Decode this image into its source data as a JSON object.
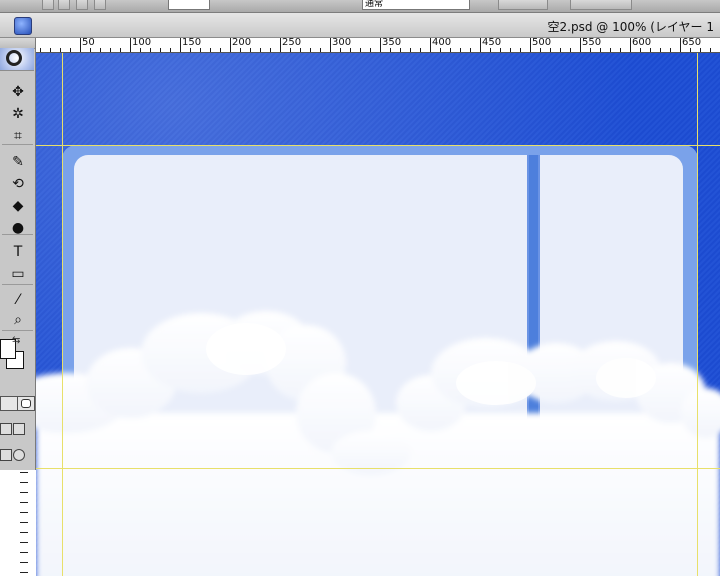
{
  "window": {
    "document_title": "空2.psd @ 100% (レイヤー 1"
  },
  "options_bar": {
    "mode_value": "通常"
  },
  "ruler": {
    "labels": [
      "50",
      "100",
      "150",
      "200",
      "250",
      "300",
      "350",
      "400",
      "450",
      "500",
      "550",
      "600",
      "650"
    ]
  },
  "toolbox": {
    "tools": [
      {
        "name": "move-tool-icon",
        "glyph": "✥"
      },
      {
        "name": "magic-wand-tool-icon",
        "glyph": "✲"
      },
      {
        "name": "crop-tool-icon",
        "glyph": "⌗"
      },
      {
        "name": "brush-tool-icon",
        "glyph": "✎"
      },
      {
        "name": "history-brush-tool-icon",
        "glyph": "⟲"
      },
      {
        "name": "paint-bucket-tool-icon",
        "glyph": "◆"
      },
      {
        "name": "dodge-tool-icon",
        "glyph": "●"
      },
      {
        "name": "type-tool-icon",
        "glyph": "T"
      },
      {
        "name": "shape-tool-icon",
        "glyph": "▭"
      },
      {
        "name": "eyedropper-tool-icon",
        "glyph": "⁄"
      },
      {
        "name": "zoom-tool-icon",
        "glyph": "⌕"
      }
    ]
  },
  "colors": {
    "sky_blue": "#1a46c8",
    "panel_frame": "#7aa2ea",
    "panel_fill": "#e9eefa",
    "guide": "#e8e06a"
  }
}
